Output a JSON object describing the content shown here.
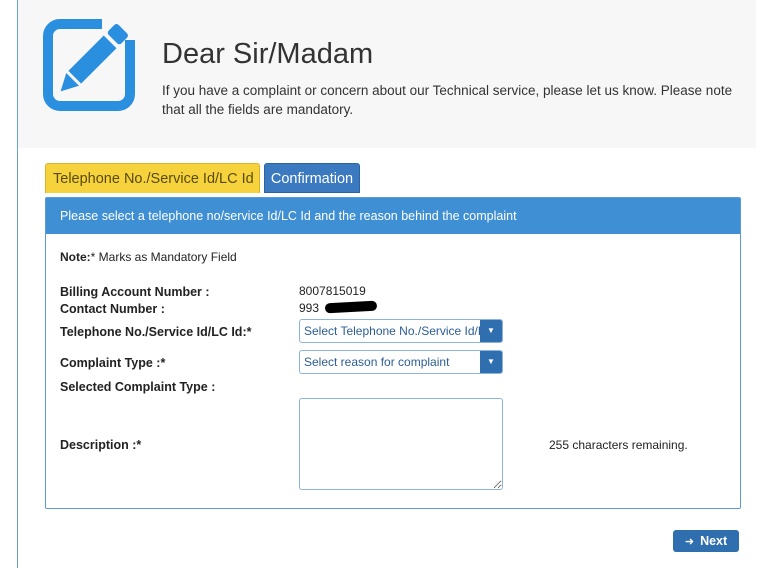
{
  "header": {
    "title": "Dear Sir/Madam",
    "intro": "If you have a complaint or concern about our Technical service, please let us know. Please note that all the fields are mandatory."
  },
  "tabs": [
    {
      "label": "Telephone No./Service Id/LC Id",
      "active": true
    },
    {
      "label": "Confirmation",
      "active": false
    }
  ],
  "panel": {
    "heading": "Please select a telephone no/service Id/LC Id and the reason behind the complaint",
    "note_label": "Note:",
    "note_text": "* Marks as Mandatory Field",
    "billing_label": "Billing Account Number :",
    "billing_value": "8007815019",
    "contact_label": "Contact Number :",
    "contact_value": "993",
    "telephone_label": "Telephone No./Service Id/LC Id:*",
    "telephone_select": "Select Telephone No./Service Id/LC Id",
    "complaint_label": "Complaint Type :*",
    "complaint_select": "Select reason for complaint",
    "selected_type_label": "Selected Complaint Type :",
    "description_label": "Description :*",
    "description_value": "",
    "chars_remaining": "255 characters remaining."
  },
  "actions": {
    "next_label": "Next"
  },
  "colors": {
    "accent_blue": "#3f8fd5",
    "button_blue": "#2f6eaf",
    "active_tab": "#f6d23d"
  }
}
